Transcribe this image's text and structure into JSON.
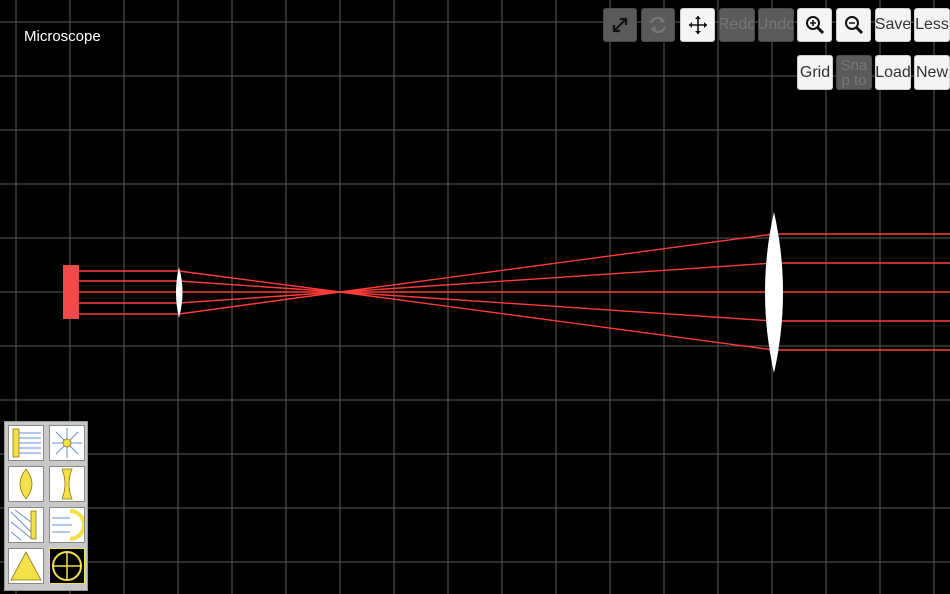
{
  "scene": {
    "title": "Microscope",
    "colors": {
      "background": "#000000",
      "grid": "#5a5a5a",
      "ray": "#ff3b3b",
      "lens": "#ffffff",
      "source": "#f24a4a",
      "tool_icon": "#f4e04a"
    }
  },
  "toolbar": {
    "row1": [
      {
        "name": "expand-icon",
        "label": "",
        "dim": true
      },
      {
        "name": "rotate-icon",
        "label": "",
        "dim": true
      },
      {
        "name": "move-icon",
        "label": "",
        "dim": false
      },
      {
        "name": "redo-button",
        "label": "Redo",
        "dim": true
      },
      {
        "name": "undo-button",
        "label": "Undo",
        "dim": true
      },
      {
        "name": "zoom-in-icon",
        "label": "",
        "dim": false
      },
      {
        "name": "zoom-out-icon",
        "label": "",
        "dim": false
      },
      {
        "name": "save-button",
        "label": "Save",
        "dim": false
      },
      {
        "name": "less-button",
        "label": "Less",
        "dim": false
      }
    ],
    "row2": [
      {
        "name": "grid-button",
        "label": "Grid",
        "dim": false
      },
      {
        "name": "snap-to-button",
        "label": "Sna p to",
        "dim": true
      },
      {
        "name": "load-button",
        "label": "Load",
        "dim": false
      },
      {
        "name": "new-button",
        "label": "New",
        "dim": false
      }
    ]
  },
  "palette": {
    "tools": [
      "parallel-source-tool-icon",
      "point-source-tool-icon",
      "convex-lens-tool-icon",
      "concave-lens-tool-icon",
      "mirror-tool-icon",
      "curved-mirror-tool-icon",
      "prism-tool-icon",
      "detector-tool-icon"
    ]
  }
}
